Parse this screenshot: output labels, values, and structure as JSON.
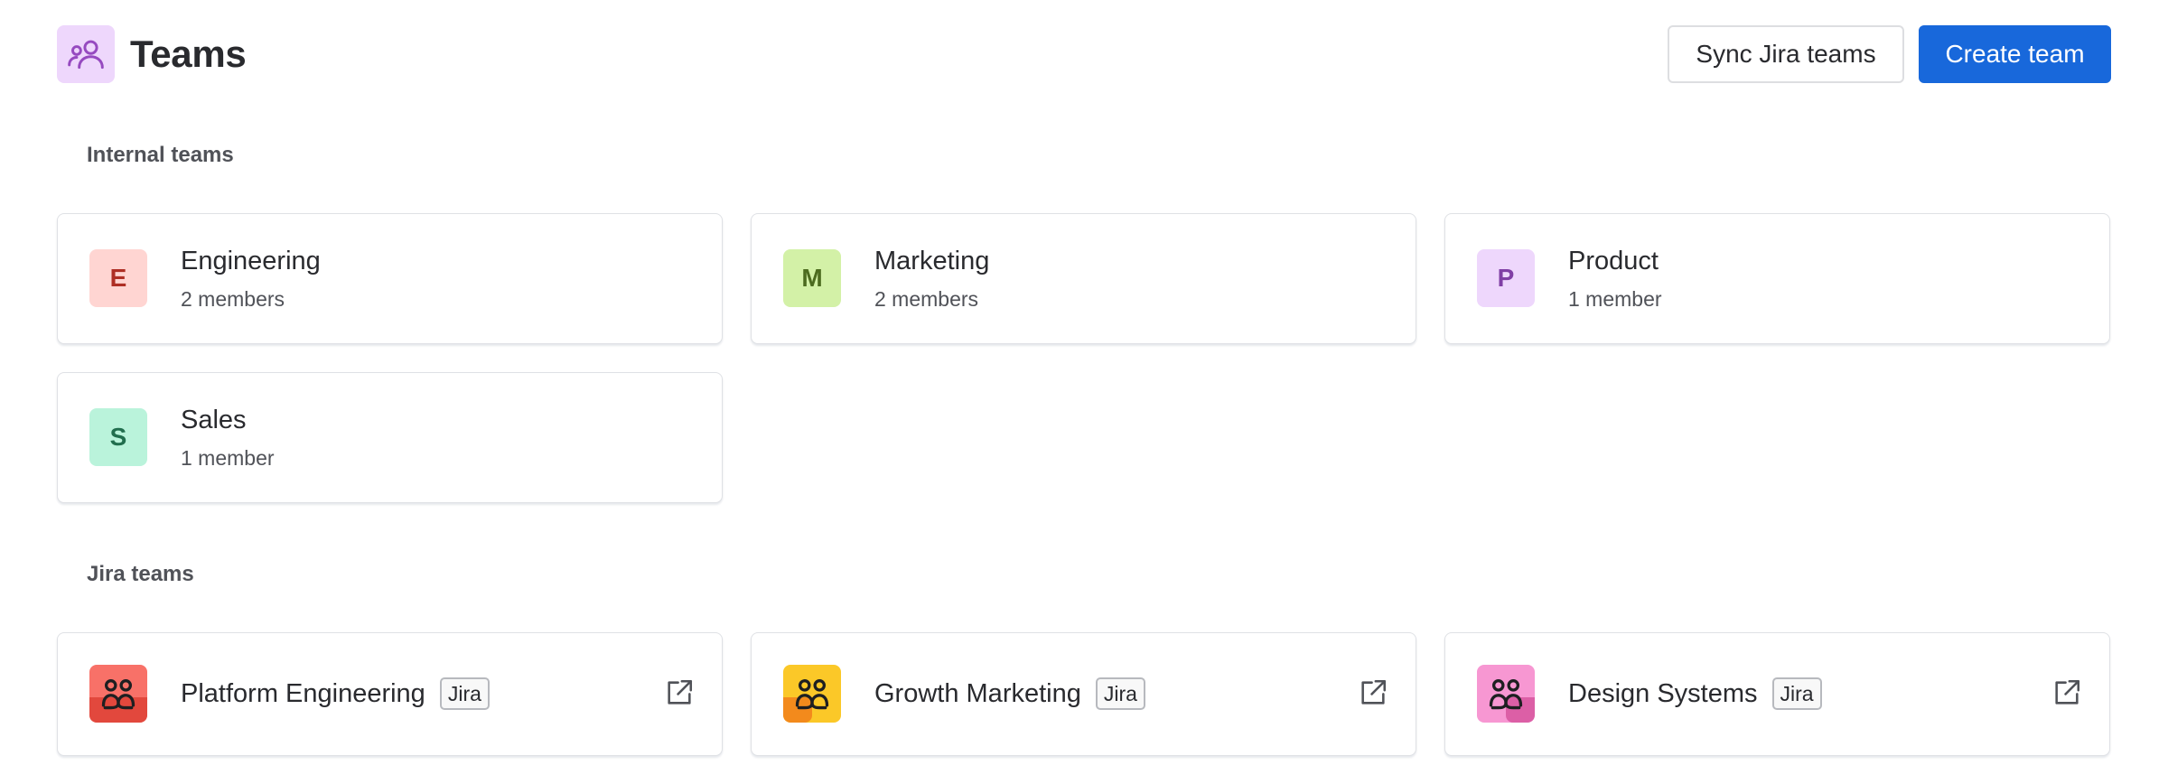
{
  "header": {
    "title": "Teams",
    "title_icon": "team-icon",
    "sync_button_label": "Sync Jira teams",
    "create_button_label": "Create team"
  },
  "internal_section": {
    "label": "Internal teams",
    "teams": [
      {
        "initial": "E",
        "name": "Engineering",
        "members": "2 members",
        "bg": "#ffd5d2",
        "fg": "#ae2e24"
      },
      {
        "initial": "M",
        "name": "Marketing",
        "members": "2 members",
        "bg": "#d3f1a7",
        "fg": "#4c6b1f"
      },
      {
        "initial": "P",
        "name": "Product",
        "members": "1 member",
        "bg": "#eed7fc",
        "fg": "#803fa5"
      },
      {
        "initial": "S",
        "name": "Sales",
        "members": "1 member",
        "bg": "#baf3db",
        "fg": "#216e4e"
      }
    ]
  },
  "jira_section": {
    "label": "Jira teams",
    "teams": [
      {
        "name": "Platform Engineering",
        "badge": "Jira",
        "icon": "team-icon",
        "color_top": "#f87168",
        "color_bottom": "#e2483d"
      },
      {
        "name": "Growth Marketing",
        "badge": "Jira",
        "icon": "team-icon",
        "color_top": "#fbc828",
        "color_bottom": "#f38a1c"
      },
      {
        "name": "Design Systems",
        "badge": "Jira",
        "icon": "team-icon",
        "color_top": "#f797d2",
        "color_bottom": "#dc5fa6"
      }
    ],
    "external_link_icon": "external-link-icon"
  },
  "colors": {
    "primary": "#1868db",
    "text": "#292a2e",
    "subtle_text": "#505258",
    "border": "#dfe1e5"
  }
}
